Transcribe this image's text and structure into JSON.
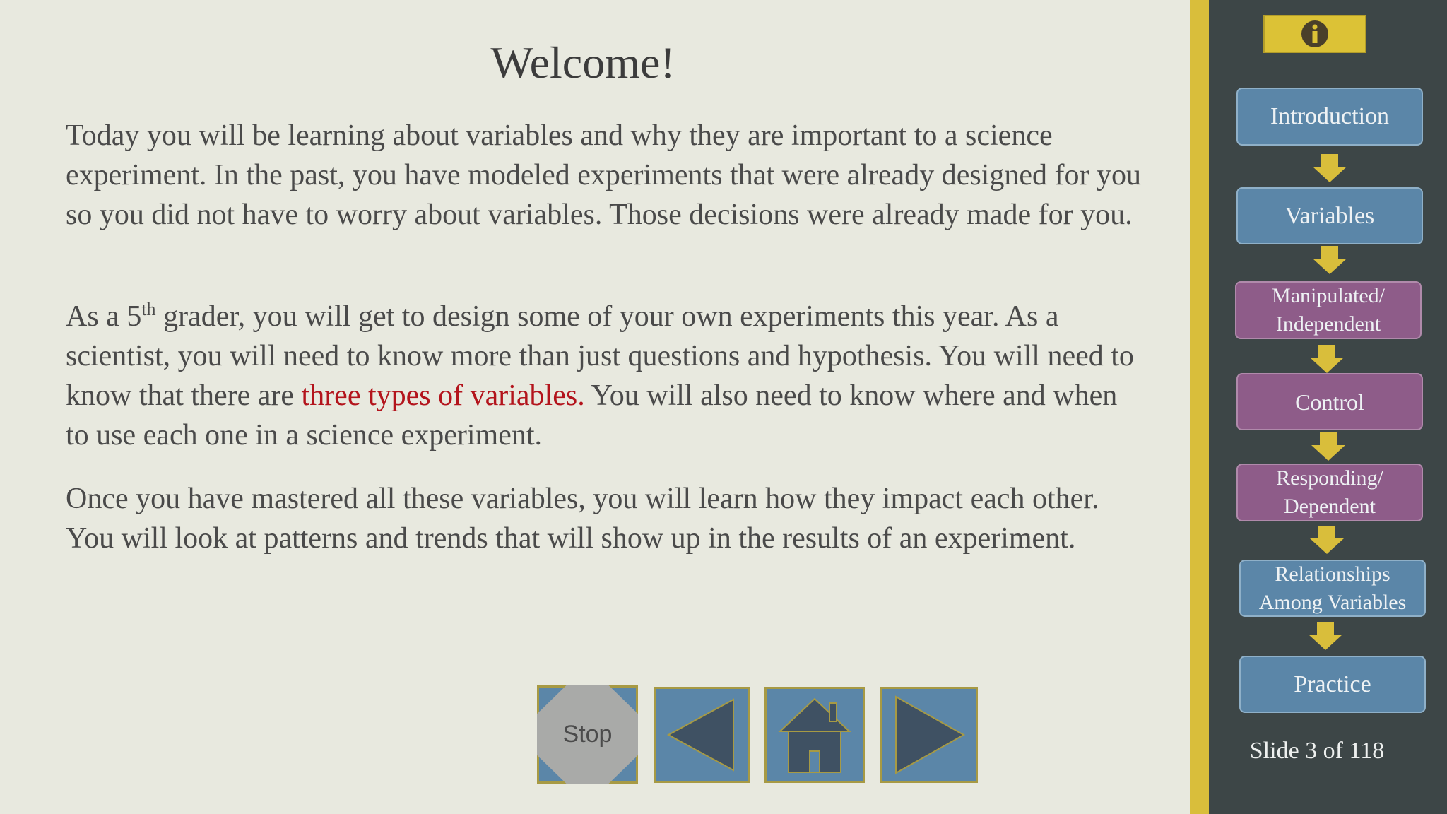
{
  "slide": {
    "title": "Welcome!",
    "paragraph1": "Today you will be learning about variables and why they are important to a science experiment.  In the past, you have modeled experiments that were already designed for you so you did not have to worry about variables. Those decisions were already made for you.",
    "paragraph2_part1": "As a 5",
    "paragraph2_sup": "th",
    "paragraph2_part2": " grader, you will get to design some of your own experiments this year.  As a scientist, you will need to know more than just questions and hypothesis.  You will need to know that there are ",
    "paragraph2_highlight": "three types of variables.",
    "paragraph2_part3": "  You will also need to know where and when to use each one in a science experiment.",
    "paragraph3": "Once you have mastered all these variables, you will learn how they impact each other.  You will look at patterns and trends that will show up in the results of an experiment."
  },
  "nav": {
    "stop_label": "Stop",
    "back_icon": "triangle-left-icon",
    "home_icon": "house-icon",
    "forward_icon": "triangle-right-icon"
  },
  "sidebar": {
    "info_icon": "info-icon",
    "items": [
      {
        "label": "Introduction",
        "color": "#5b86a8"
      },
      {
        "label": "Variables",
        "color": "#5b86a8"
      },
      {
        "label_line1": "Manipulated/",
        "label_line2": "Independent",
        "color": "#8e5c89"
      },
      {
        "label": "Control",
        "color": "#8e5c89"
      },
      {
        "label_line1": "Responding/",
        "label_line2": "Dependent",
        "color": "#8e5c89"
      },
      {
        "label_line1": "Relationships",
        "label_line2": "Among Variables",
        "color": "#5b86a8"
      },
      {
        "label": "Practice",
        "color": "#5b86a8"
      }
    ],
    "slide_counter": "Slide 3 of 118"
  },
  "colors": {
    "background": "#e8e9df",
    "sidebar": "#3d4647",
    "accent_yellow": "#d9be3b",
    "highlight_red": "#b3141c"
  }
}
